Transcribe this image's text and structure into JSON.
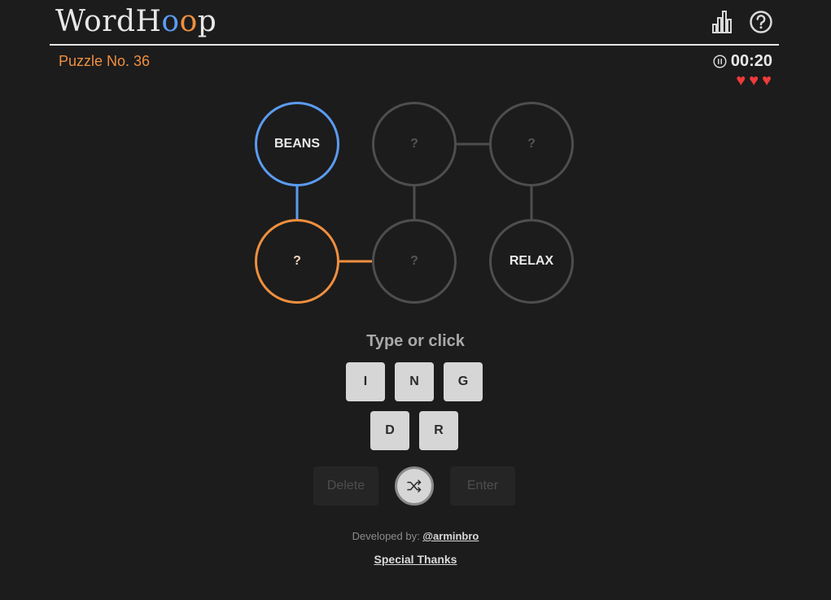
{
  "header": {
    "logo_prefix": "WordH",
    "logo_o1": "o",
    "logo_o2": "o",
    "logo_suffix": "p",
    "stats_icon": "bar-chart-icon",
    "help_icon": "question-circle-icon",
    "accent_blue": "#5b9cf0",
    "accent_orange": "#ef8f3f"
  },
  "puzzle": {
    "number_label": "Puzzle No. 36",
    "timer": "00:20",
    "pause_icon": "pause-circle-icon",
    "lives": [
      "♥",
      "♥",
      "♥"
    ],
    "heart_color": "#ee3b3b"
  },
  "board": {
    "nodes": [
      {
        "label": "BEANS",
        "state": "solved-blue"
      },
      {
        "label": "?",
        "state": "unsolved"
      },
      {
        "label": "?",
        "state": "unsolved"
      },
      {
        "label": "?",
        "state": "active-orange"
      },
      {
        "label": "?",
        "state": "unsolved"
      },
      {
        "label": "RELAX",
        "state": "solved"
      }
    ]
  },
  "input": {
    "prompt": "Type or click",
    "letters": [
      "I",
      "N",
      "G",
      "D",
      "R"
    ]
  },
  "actions": {
    "delete_label": "Delete",
    "enter_label": "Enter",
    "shuffle_icon": "shuffle-icon"
  },
  "footer": {
    "developed_by": "Developed by:",
    "developer_handle": "@arminbro",
    "special_thanks": "Special Thanks"
  }
}
